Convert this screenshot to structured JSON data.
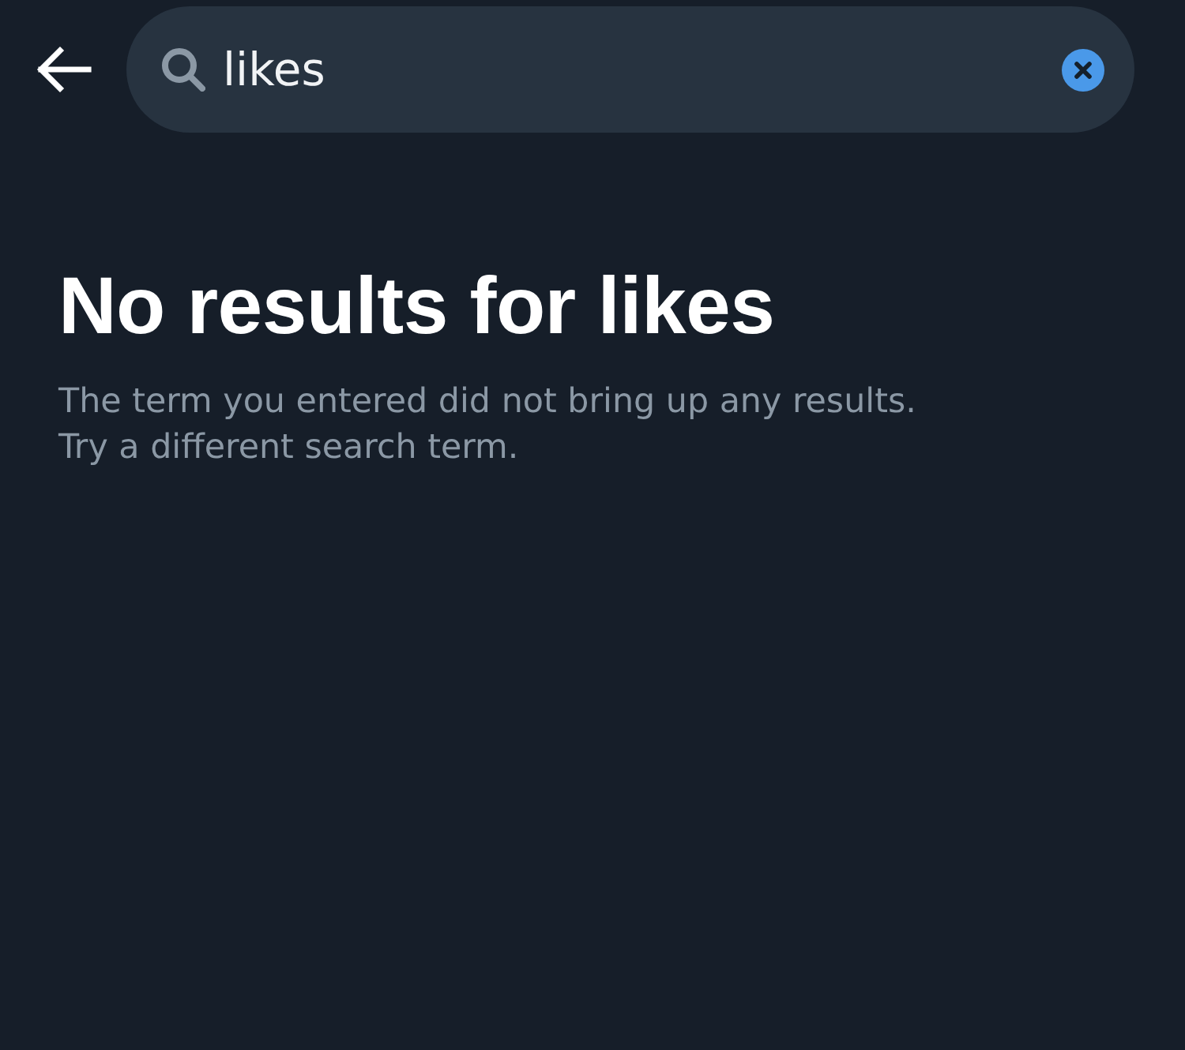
{
  "search": {
    "value": "likes"
  },
  "empty_state": {
    "title": "No results for likes",
    "message": "The term you entered did not bring up any results.\nTry a different search term."
  }
}
